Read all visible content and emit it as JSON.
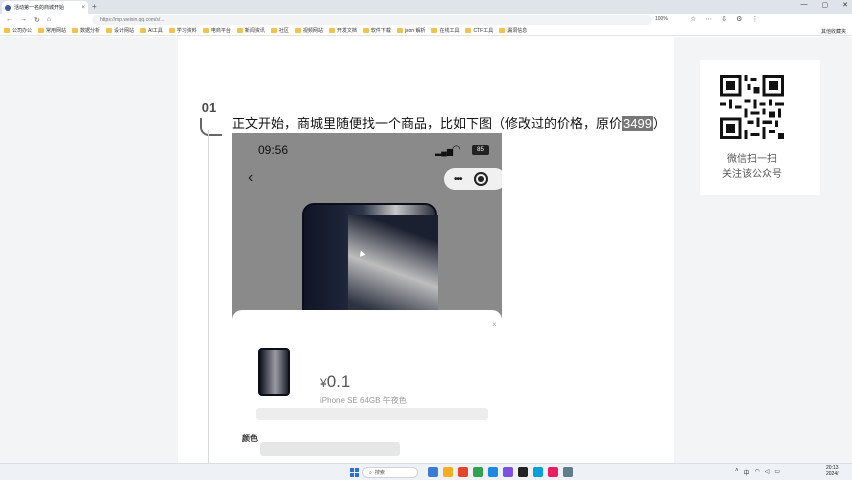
{
  "browser": {
    "tab_title": "活动第一名的商城开始",
    "tab_close": "×",
    "new_tab": "+",
    "window_controls": [
      "—",
      "▢",
      "✕"
    ],
    "nav": [
      "←",
      "→",
      "↻",
      "⌂"
    ],
    "url": "https://mp.weixin.qq.com/s/...",
    "zoom": "100%",
    "tools": [
      "☆",
      "⋯",
      "⇩",
      "⚙",
      "⋮"
    ]
  },
  "bookmarks": {
    "items": [
      "公司办公",
      "常用网站",
      "数据分析",
      "设计网站",
      "AI工具",
      "学习资料",
      "电商平台",
      "新闻资讯",
      "社区",
      "视频网站",
      "开发文档",
      "软件下载",
      "json 解析",
      "在线工具",
      "CTF工具",
      "漏洞信息"
    ],
    "right": "其他收藏夹"
  },
  "sidebar": {
    "qr_caption_line1": "微信扫一扫",
    "qr_caption_line2": "关注该公众号"
  },
  "article": {
    "step_number": "01",
    "heading_text": "正文开始，商城里随便找一个商品，比如下图（修改过的价格，原价",
    "heading_highlight": "3499",
    "heading_end": "）"
  },
  "phone": {
    "time": "09:56",
    "signal": "▂▄▆",
    "wifi": "◠",
    "battery": "85",
    "back": "‹",
    "more": "•••",
    "currency": "¥",
    "price": "0.1",
    "product_name": "iPhone SE 64GB 午夜色",
    "close": "×",
    "color_label": "颜色"
  },
  "taskbar": {
    "search_placeholder": "搜索",
    "clock_time": "20:13",
    "clock_date": "2024/"
  },
  "colors": {
    "accent": "#2a6fd1",
    "gutter": "#f3f4f6",
    "phone_bg": "#8a8a8a"
  }
}
